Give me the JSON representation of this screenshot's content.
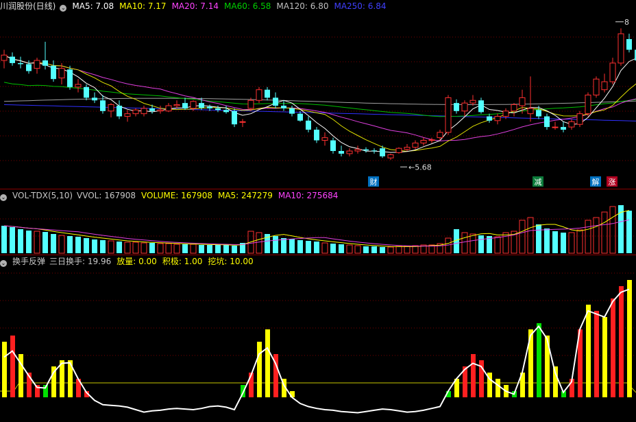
{
  "header": {
    "stock_name": "川润股份(日线)",
    "ma_labels": [
      {
        "label": "MA5: 7.08",
        "color": "#ffffff"
      },
      {
        "label": "MA10: 7.17",
        "color": "#ffff00"
      },
      {
        "label": "MA20: 7.14",
        "color": "#ff44ff"
      },
      {
        "label": "MA60: 6.58",
        "color": "#00d000"
      },
      {
        "label": "MA120: 6.80",
        "color": "#c0c0c0"
      },
      {
        "label": "MA250: 6.84",
        "color": "#4040ff"
      }
    ]
  },
  "volume_header": {
    "name": "VOL-TDX(5,10)",
    "items": [
      {
        "label": "VVOL: 167908",
        "color": "#c8c8c8"
      },
      {
        "label": "VOLUME: 167908",
        "color": "#ffff00"
      },
      {
        "label": "MA5: 247279",
        "color": "#ffff00"
      },
      {
        "label": "MA10: 275684",
        "color": "#ff44ff"
      }
    ]
  },
  "indicator_header": {
    "name": "换手反弹",
    "items": [
      {
        "label": "三日换手: 19.96",
        "color": "#c8c8c8"
      },
      {
        "label": "放量: 0.00",
        "color": "#ffff00"
      },
      {
        "label": "积极: 1.00",
        "color": "#ffff00"
      },
      {
        "label": "挖坑: 10.00",
        "color": "#ffff00"
      }
    ]
  },
  "chart_data": [
    {
      "type": "candlestick",
      "title": "川润股份(日线)",
      "ylim": [
        5.4,
        8.4
      ],
      "annotations": [
        {
          "text": "5.68",
          "x_index": 48,
          "value": 5.68
        },
        {
          "text": "8",
          "x_index": 75,
          "value": 8.3
        }
      ],
      "event_markers": [
        {
          "text": "财",
          "x_index": 45,
          "bg": "#0070c0"
        },
        {
          "text": "减",
          "x_index": 65,
          "bg": "#0c7a3a"
        },
        {
          "text": "解",
          "x_index": 72,
          "bg": "#0070c0"
        },
        {
          "text": "涨",
          "x_index": 74,
          "bg": "#b00020"
        }
      ],
      "candles": [
        [
          7.55,
          7.75,
          7.4,
          7.65
        ],
        [
          7.62,
          7.7,
          7.45,
          7.5
        ],
        [
          7.5,
          7.62,
          7.4,
          7.48
        ],
        [
          7.48,
          7.55,
          7.3,
          7.35
        ],
        [
          7.4,
          7.6,
          7.3,
          7.55
        ],
        [
          7.55,
          7.9,
          7.38,
          7.45
        ],
        [
          7.45,
          7.55,
          7.15,
          7.2
        ],
        [
          7.22,
          7.5,
          7.1,
          7.4
        ],
        [
          7.38,
          7.45,
          7.0,
          7.05
        ],
        [
          7.05,
          7.2,
          6.95,
          7.1
        ],
        [
          7.05,
          7.1,
          6.8,
          6.85
        ],
        [
          6.85,
          6.95,
          6.75,
          6.8
        ],
        [
          6.8,
          6.9,
          6.55,
          6.6
        ],
        [
          6.6,
          6.75,
          6.48,
          6.72
        ],
        [
          6.7,
          6.8,
          6.45,
          6.5
        ],
        [
          6.5,
          6.62,
          6.4,
          6.55
        ],
        [
          6.55,
          6.65,
          6.5,
          6.62
        ],
        [
          6.55,
          6.7,
          6.5,
          6.65
        ],
        [
          6.65,
          6.72,
          6.55,
          6.6
        ],
        [
          6.6,
          6.7,
          6.55,
          6.62
        ],
        [
          6.6,
          6.75,
          6.58,
          6.7
        ],
        [
          6.7,
          6.8,
          6.65,
          6.72
        ],
        [
          6.75,
          6.85,
          6.62,
          6.65
        ],
        [
          6.65,
          6.8,
          6.6,
          6.78
        ],
        [
          6.75,
          6.85,
          6.62,
          6.66
        ],
        [
          6.68,
          6.72,
          6.6,
          6.65
        ],
        [
          6.65,
          6.7,
          6.58,
          6.62
        ],
        [
          6.62,
          6.7,
          6.55,
          6.58
        ],
        [
          6.6,
          6.65,
          6.3,
          6.35
        ],
        [
          6.4,
          6.45,
          6.3,
          6.4
        ],
        [
          6.65,
          6.85,
          6.6,
          6.8
        ],
        [
          6.8,
          7.05,
          6.75,
          7.0
        ],
        [
          7.0,
          7.05,
          6.8,
          6.85
        ],
        [
          6.85,
          6.95,
          6.65,
          6.7
        ],
        [
          6.7,
          6.8,
          6.6,
          6.65
        ],
        [
          6.65,
          6.7,
          6.5,
          6.55
        ],
        [
          6.55,
          6.6,
          6.4,
          6.42
        ],
        [
          6.42,
          6.5,
          6.2,
          6.25
        ],
        [
          6.25,
          6.3,
          6.0,
          6.05
        ],
        [
          6.05,
          6.2,
          5.95,
          6.1
        ],
        [
          6.05,
          6.1,
          5.8,
          5.85
        ],
        [
          5.85,
          5.95,
          5.75,
          5.8
        ],
        [
          5.8,
          5.9,
          5.75,
          5.85
        ],
        [
          5.85,
          5.95,
          5.8,
          5.88
        ],
        [
          5.88,
          5.92,
          5.82,
          5.86
        ],
        [
          5.86,
          5.9,
          5.8,
          5.85
        ],
        [
          5.9,
          5.95,
          5.72,
          5.75
        ],
        [
          5.72,
          5.8,
          5.68,
          5.78
        ],
        [
          5.82,
          5.92,
          5.8,
          5.9
        ],
        [
          5.88,
          5.98,
          5.85,
          5.92
        ],
        [
          5.92,
          6.05,
          5.88,
          6.0
        ],
        [
          6.0,
          6.1,
          5.95,
          6.05
        ],
        [
          6.05,
          6.1,
          6.0,
          6.06
        ],
        [
          6.1,
          6.25,
          6.05,
          6.2
        ],
        [
          6.2,
          6.9,
          6.15,
          6.85
        ],
        [
          6.75,
          6.82,
          6.55,
          6.6
        ],
        [
          6.6,
          6.8,
          6.5,
          6.75
        ],
        [
          6.75,
          6.9,
          6.7,
          6.8
        ],
        [
          6.8,
          6.85,
          6.55,
          6.58
        ],
        [
          6.5,
          6.55,
          6.38,
          6.42
        ],
        [
          6.42,
          6.55,
          6.35,
          6.5
        ],
        [
          6.5,
          6.65,
          6.45,
          6.6
        ],
        [
          6.6,
          6.75,
          6.5,
          6.72
        ],
        [
          6.7,
          7.0,
          6.55,
          6.85
        ],
        [
          6.55,
          7.25,
          6.4,
          6.65
        ],
        [
          6.62,
          6.7,
          6.45,
          6.5
        ],
        [
          6.5,
          6.55,
          6.25,
          6.3
        ],
        [
          6.3,
          6.4,
          6.25,
          6.3
        ],
        [
          6.3,
          6.4,
          6.2,
          6.25
        ],
        [
          6.3,
          6.45,
          6.25,
          6.4
        ],
        [
          6.35,
          6.6,
          6.3,
          6.55
        ],
        [
          6.55,
          6.95,
          6.5,
          6.9
        ],
        [
          6.9,
          7.25,
          6.85,
          7.2
        ],
        [
          7.0,
          7.3,
          6.95,
          7.15
        ],
        [
          7.15,
          7.6,
          7.1,
          7.5
        ],
        [
          7.5,
          8.15,
          7.45,
          8.05
        ],
        [
          7.95,
          8.05,
          7.7,
          7.75
        ],
        [
          7.75,
          7.85,
          7.35,
          7.55
        ]
      ]
    },
    {
      "type": "bar",
      "title": "VOL-TDX(5,10)",
      "values": [
        40,
        38,
        35,
        33,
        32,
        31,
        28,
        26,
        25,
        24,
        22,
        20,
        19,
        18,
        17,
        16,
        16,
        15,
        15,
        14,
        14,
        13,
        13,
        13,
        12,
        12,
        12,
        12,
        11,
        15,
        32,
        30,
        28,
        25,
        22,
        21,
        19,
        18,
        17,
        15,
        14,
        13,
        12,
        11,
        10,
        10,
        9,
        9,
        10,
        10,
        11,
        12,
        12,
        14,
        22,
        35,
        30,
        28,
        26,
        25,
        24,
        30,
        32,
        48,
        52,
        42,
        36,
        32,
        30,
        30,
        34,
        48,
        52,
        60,
        68,
        70,
        62
      ],
      "up": [
        false,
        false,
        false,
        false,
        true,
        false,
        false,
        true,
        false,
        false,
        false,
        false,
        false,
        true,
        false,
        true,
        true,
        true,
        false,
        true,
        true,
        true,
        false,
        true,
        false,
        false,
        false,
        false,
        false,
        false,
        true,
        true,
        false,
        false,
        false,
        false,
        false,
        false,
        false,
        true,
        false,
        false,
        true,
        true,
        false,
        false,
        false,
        true,
        true,
        true,
        true,
        true,
        true,
        true,
        true,
        false,
        true,
        true,
        false,
        false,
        true,
        true,
        true,
        true,
        true,
        false,
        false,
        false,
        false,
        true,
        true,
        true,
        true,
        true,
        true,
        false,
        false
      ]
    },
    {
      "type": "bar",
      "title": "换手反弹",
      "values": [
        9,
        10,
        7,
        4,
        2,
        2,
        5,
        6,
        6,
        3,
        1,
        1,
        0,
        0,
        0,
        0,
        0,
        0,
        0,
        0,
        0,
        0,
        0,
        0,
        0,
        0,
        0,
        0,
        0,
        2,
        4,
        9,
        11,
        7,
        3,
        1,
        0,
        0,
        0,
        0,
        0,
        0,
        0,
        0,
        0,
        0,
        0,
        0,
        0,
        0,
        0,
        0,
        0,
        0,
        1,
        3,
        5,
        7,
        6,
        4,
        3,
        2,
        1,
        4,
        11,
        12,
        10,
        5,
        1,
        3,
        11,
        15,
        14,
        13,
        16,
        18,
        19
      ],
      "bar_colors": [
        "yellow",
        "red",
        "yellow",
        "red",
        "red",
        "green",
        "yellow",
        "yellow",
        "yellow",
        "red",
        "red",
        "",
        "",
        "",
        "",
        "",
        "",
        "",
        "",
        "",
        "",
        "",
        "",
        "",
        "",
        "",
        "",
        "",
        "",
        "green",
        "red",
        "yellow",
        "yellow",
        "red",
        "yellow",
        "yellow",
        "",
        "",
        "",
        "",
        "",
        "",
        "",
        "",
        "",
        "",
        "",
        "",
        "",
        "",
        "",
        "",
        "",
        "",
        "green",
        "yellow",
        "red",
        "red",
        "red",
        "yellow",
        "yellow",
        "yellow",
        "green",
        "yellow",
        "yellow",
        "green",
        "yellow",
        "yellow",
        "green",
        "red",
        "red",
        "yellow",
        "red",
        "yellow",
        "red",
        "red",
        "yellow"
      ],
      "line": [
        6.5,
        7.5,
        5.5,
        3.5,
        1.6,
        1.5,
        4.0,
        5.5,
        5.6,
        3.0,
        0.8,
        -0.5,
        -1.2,
        -1.3,
        -1.4,
        -1.6,
        -2.0,
        -2.4,
        -2.2,
        -2.1,
        -1.9,
        -1.8,
        -1.9,
        -2.0,
        -1.8,
        -1.5,
        -1.4,
        -1.6,
        -2.0,
        0.6,
        3.5,
        7.0,
        8.0,
        5.5,
        2.0,
        0.0,
        -1.0,
        -1.5,
        -1.8,
        -2.0,
        -2.1,
        -2.3,
        -2.4,
        -2.5,
        -2.3,
        -2.1,
        -1.9,
        -2.0,
        -2.2,
        -2.4,
        -2.3,
        -2.1,
        -1.8,
        -1.5,
        1.0,
        3.0,
        4.5,
        5.5,
        5.0,
        3.0,
        2.0,
        1.0,
        0.5,
        4.0,
        10.0,
        11.5,
        9.5,
        4.0,
        0.8,
        2.5,
        11.0,
        14.0,
        13.5,
        13.0,
        15.5,
        17.0,
        17.5
      ],
      "ylim": [
        -4,
        21
      ]
    }
  ]
}
